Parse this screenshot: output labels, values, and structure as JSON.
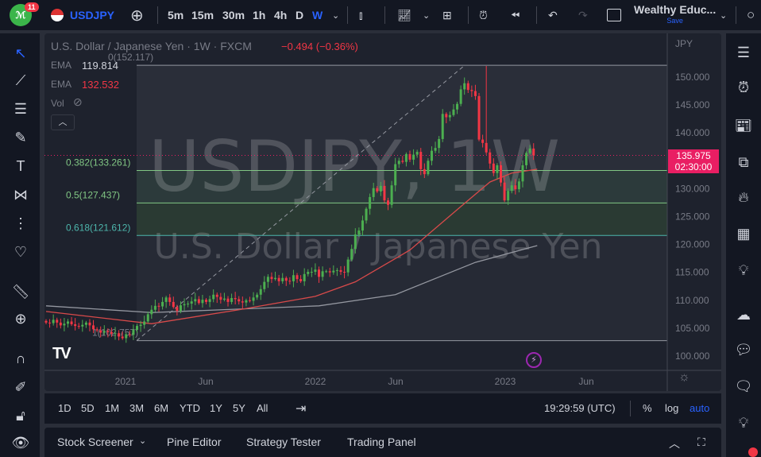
{
  "topbar": {
    "notification_count": "11",
    "symbol": "USDJPY",
    "intervals": [
      "5m",
      "15m",
      "30m",
      "1h",
      "4h",
      "D",
      "W"
    ],
    "active_interval": "W",
    "layout_name": "Wealthy Educ...",
    "save_label": "Save"
  },
  "legend": {
    "title": "U.S. Dollar / Japanese Yen · 1W · FXCM",
    "change": "−0.494 (−0.36%)",
    "ema1_label": "EMA",
    "ema1_value": "119.814",
    "ema2_label": "EMA",
    "ema2_value": "132.532",
    "vol_label": "Vol"
  },
  "watermark": {
    "line1": "USDJPY, 1W",
    "line2": "U.S. Dollar / Japanese Yen"
  },
  "price_axis": {
    "currency": "JPY",
    "ticks": [
      "150.000",
      "145.000",
      "140.000",
      "135.000",
      "130.000",
      "125.000",
      "120.000",
      "115.000",
      "110.000",
      "105.000",
      "100.000"
    ],
    "last_price": "135.975",
    "countdown": "02:30:00"
  },
  "time_axis": {
    "ticks": [
      "2021",
      "Jun",
      "2022",
      "Jun",
      "2023",
      "Jun"
    ]
  },
  "fib": {
    "levels": [
      {
        "ratio": 0,
        "price": 152.117,
        "label": "0(152.117)"
      },
      {
        "ratio": 0.382,
        "price": 133.261,
        "label": "0.382(133.261)"
      },
      {
        "ratio": 0.5,
        "price": 127.437,
        "label": "0.5(127.437)"
      },
      {
        "ratio": 0.618,
        "price": 121.612,
        "label": "0.618(121.612)"
      },
      {
        "ratio": 1,
        "price": 102.757,
        "label": "1(102.757)"
      }
    ]
  },
  "range_bar": {
    "ranges": [
      "1D",
      "5D",
      "1M",
      "3M",
      "6M",
      "YTD",
      "1Y",
      "5Y",
      "All"
    ],
    "clock": "19:29:59 (UTC)",
    "percent": "%",
    "log": "log",
    "auto": "auto"
  },
  "bottom_panel": {
    "tabs": [
      "Stock Screener",
      "Pine Editor",
      "Strategy Tester",
      "Trading Panel"
    ]
  },
  "colors": {
    "up": "#26a69a",
    "down": "#ef5350",
    "accent": "#2962ff",
    "price_label": "#e91e63"
  },
  "chart_data": {
    "type": "candlestick",
    "ylim": [
      98,
      155
    ],
    "start_week_offset": 0,
    "closes": [
      106,
      105.9,
      106.5,
      106,
      105.5,
      105.8,
      106.2,
      105.7,
      105.4,
      105.3,
      105.6,
      106,
      105.5,
      104.8,
      104.6,
      104.2,
      104.5,
      104.3,
      104,
      104.1,
      103.5,
      103.2,
      103.9,
      103.8,
      104.7,
      105.4,
      105.6,
      106.2,
      107.5,
      108.3,
      109,
      108.9,
      109.7,
      110.5,
      109.7,
      108.8,
      108.1,
      109.1,
      109.3,
      109.4,
      109.8,
      110.2,
      109.5,
      110.1,
      109.7,
      110.2,
      111,
      110.6,
      110.1,
      110.3,
      109.7,
      110.4,
      110.2,
      109.8,
      109.6,
      110,
      109.9,
      110.5,
      111,
      112,
      113.3,
      114.2,
      113.8,
      114,
      113.4,
      114,
      113.5,
      113.4,
      114.5,
      113.8,
      113.4,
      114.7,
      115.1,
      115.1,
      115.5,
      114.2,
      115.2,
      115.2,
      115,
      115.3,
      115.4,
      115.1,
      115,
      117.3,
      119.2,
      121.8,
      122.5,
      124.3,
      126.4,
      128.5,
      130.1,
      129.5,
      130.5,
      127.9,
      127.1,
      130.6,
      134.4,
      135,
      134.8,
      136.2,
      135.2,
      136.1,
      136.6,
      133.5,
      132.6,
      135,
      136.8,
      137.3,
      138.9,
      143.4,
      142.8,
      143.2,
      144.2,
      145.2,
      147.8,
      148.9,
      147.7,
      147.5,
      146.6,
      138.8,
      138.2,
      136.5,
      134.5,
      132.8,
      134.2,
      131.1,
      127.9,
      129.6,
      130.6,
      129.9,
      131.3,
      134.2,
      136.4,
      137.2,
      135.975
    ],
    "ema_fast": [
      [
        0,
        108
      ],
      [
        29,
        105.8
      ],
      [
        53,
        108.3
      ],
      [
        74,
        110.7
      ],
      [
        85,
        113.3
      ],
      [
        100,
        119
      ],
      [
        114,
        126.8
      ],
      [
        122,
        131.2
      ],
      [
        128,
        132.8
      ],
      [
        135,
        133.5
      ]
    ],
    "ema_slow": [
      [
        0,
        109
      ],
      [
        29,
        107.8
      ],
      [
        75,
        109
      ],
      [
        96,
        111
      ],
      [
        118,
        116.8
      ],
      [
        135,
        119.8
      ]
    ]
  }
}
